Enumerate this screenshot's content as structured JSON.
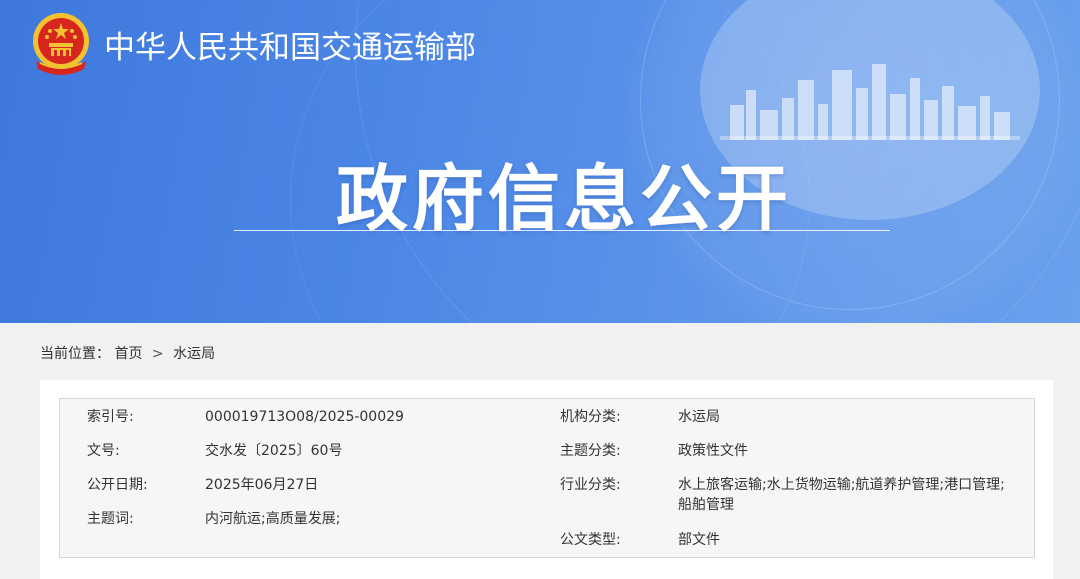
{
  "header": {
    "site_title": "中华人民共和国交通运输部",
    "banner_title": "政府信息公开"
  },
  "breadcrumb": {
    "prefix": "当前位置：",
    "home": "首页",
    "separator": ">",
    "current": "水运局"
  },
  "info": {
    "left": [
      {
        "label": "索引号:",
        "value": "000019713O08/2025-00029"
      },
      {
        "label": "文号:",
        "value": "交水发〔2025〕60号"
      },
      {
        "label": "公开日期:",
        "value": "2025年06月27日"
      },
      {
        "label": "主题词:",
        "value": "内河航运;高质量发展;"
      }
    ],
    "right": [
      {
        "label": "机构分类:",
        "value": "水运局"
      },
      {
        "label": "主题分类:",
        "value": "政策性文件"
      },
      {
        "label": "行业分类:",
        "value": "水上旅客运输;水上货物运输;航道养护管理;港口管理;船舶管理"
      },
      {
        "label": "公文类型:",
        "value": "部文件"
      }
    ]
  },
  "colors": {
    "banner_blue": "#4b86e6",
    "emblem_red": "#d7261e",
    "emblem_gold": "#f2c230"
  }
}
